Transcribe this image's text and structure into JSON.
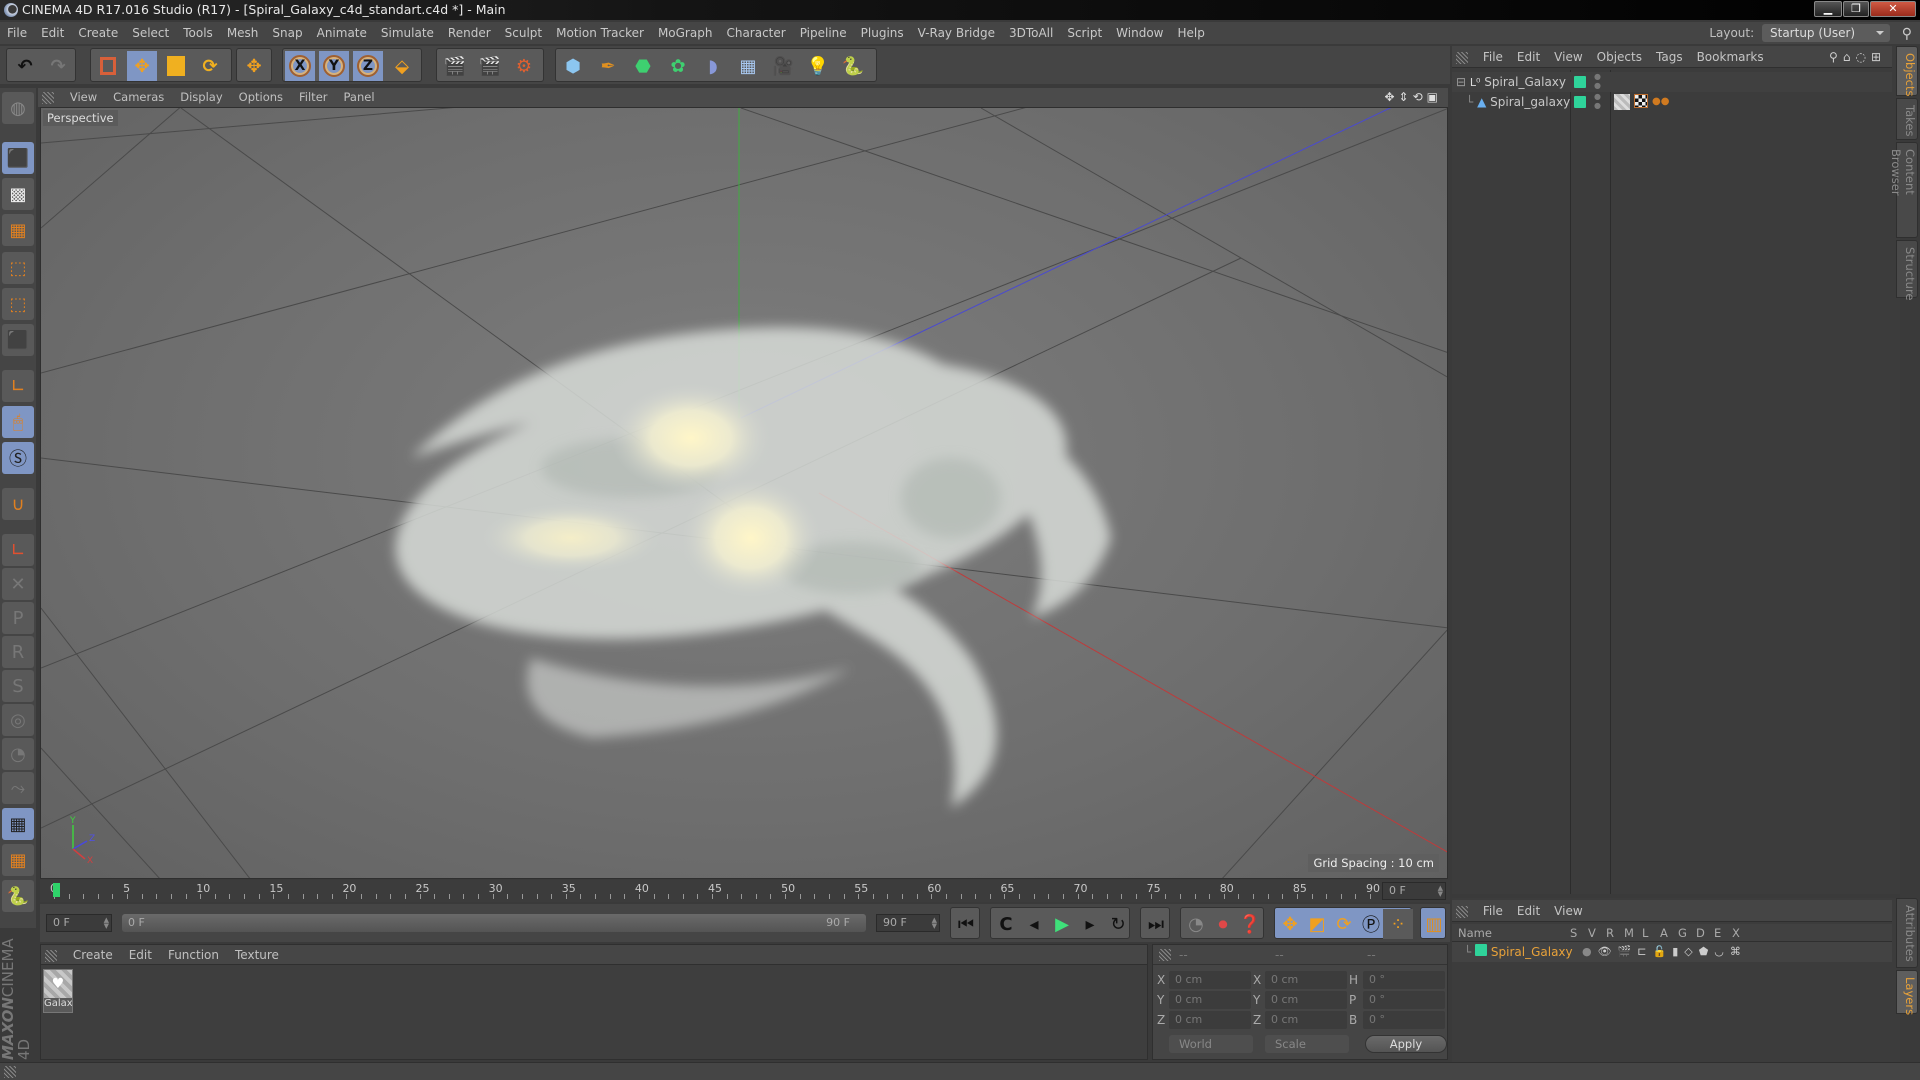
{
  "window": {
    "title": "CINEMA 4D R17.016 Studio (R17) - [Spiral_Galaxy_c4d_standart.c4d *] - Main",
    "controls": [
      "minimize",
      "restore",
      "close"
    ]
  },
  "menubar": {
    "items": [
      "File",
      "Edit",
      "Create",
      "Select",
      "Tools",
      "Mesh",
      "Snap",
      "Animate",
      "Simulate",
      "Render",
      "Sculpt",
      "Motion Tracker",
      "MoGraph",
      "Character",
      "Pipeline",
      "Plugins",
      "V-Ray Bridge",
      "3DToAll",
      "Script",
      "Window",
      "Help"
    ],
    "layout_label": "Layout:",
    "layout_value": "Startup (User)"
  },
  "toolbar": {
    "groups": [
      [
        "undo-icon",
        "redo-icon"
      ],
      [
        "live-selection-icon",
        "move-icon",
        "scale-icon",
        "rotate-icon"
      ],
      [
        "recent-tool-icon"
      ],
      [
        "x-axis-lock-icon",
        "y-axis-lock-icon",
        "z-axis-lock-icon",
        "coordinate-system-icon"
      ],
      [
        "render-view-icon",
        "render-to-picture-viewer-icon",
        "render-settings-icon"
      ],
      [
        "cube-primitive-icon",
        "pen-spline-icon",
        "subdivision-surface-icon",
        "cloner-icon",
        "deformer-icon",
        "floor-icon",
        "camera-icon",
        "light-icon",
        "python-icon"
      ]
    ],
    "axis_labels": [
      "X",
      "Y",
      "Z"
    ]
  },
  "left_tools": [
    "make-editable-icon",
    "model-mode-icon",
    "texture-mode-icon",
    "workplane-mode-icon",
    "points-mode-icon",
    "edges-mode-icon",
    "polygons-mode-icon",
    "axis-mode-icon",
    "tweak-mode-icon",
    "solo-icon",
    "snap-icon",
    "workplane-icon",
    "quantize-icon",
    "lock-p-icon",
    "lock-r-icon",
    "lock-psr-icon",
    "lock-target-icon",
    "lock-camera-icon",
    "lock-misc-icon",
    "lock-workplane-icon",
    "align-workplane-icon",
    "python-script-icon"
  ],
  "viewport": {
    "menu": [
      "View",
      "Cameras",
      "Display",
      "Options",
      "Filter",
      "Panel"
    ],
    "label": "Perspective",
    "grid_spacing": "Grid Spacing : 10 cm",
    "axis_gizmo": [
      "Y",
      "Z",
      "X"
    ]
  },
  "timeline": {
    "ticks": [
      "0",
      "5",
      "10",
      "15",
      "20",
      "25",
      "30",
      "35",
      "40",
      "45",
      "50",
      "55",
      "60",
      "65",
      "70",
      "75",
      "80",
      "85",
      "90"
    ],
    "current_frame_field": "0 F",
    "start_field": "0 F",
    "range_start": "0 F",
    "range_end": "90 F",
    "end_field": "90 F",
    "current_frame_readout": "0 F",
    "playhead_frame": 0,
    "max_frame": 90
  },
  "transport": {
    "buttons": [
      "go-to-start-icon",
      "previous-key-icon",
      "previous-frame-icon",
      "play-icon",
      "next-frame-icon",
      "next-key-icon",
      "go-to-end-icon",
      "motion-record-icon",
      "record-active-icon",
      "autokey-icon",
      "key-position-icon",
      "key-scale-icon",
      "key-rotation-icon",
      "key-parameter-icon",
      "key-pla-icon",
      "timeline-icon"
    ]
  },
  "material_panel": {
    "menu": [
      "Create",
      "Edit",
      "Function",
      "Texture"
    ],
    "materials": [
      {
        "name": "Galax"
      }
    ]
  },
  "coordinates": {
    "headers": [
      "--",
      "--",
      "--"
    ],
    "rows": [
      {
        "l1": "X",
        "v1": "0 cm",
        "l2": "X",
        "v2": "0 cm",
        "l3": "H",
        "v3": "0 °"
      },
      {
        "l1": "Y",
        "v1": "0 cm",
        "l2": "Y",
        "v2": "0 cm",
        "l3": "P",
        "v3": "0 °"
      },
      {
        "l1": "Z",
        "v1": "0 cm",
        "l2": "Z",
        "v2": "0 cm",
        "l3": "B",
        "v3": "0 °"
      }
    ],
    "space_dropdown": "World",
    "mode_dropdown": "Scale",
    "apply_label": "Apply"
  },
  "object_manager": {
    "menu": [
      "File",
      "Edit",
      "View",
      "Objects",
      "Tags",
      "Bookmarks"
    ],
    "objects": [
      {
        "name": "Spiral_Galaxy",
        "icon": "null-object-icon",
        "color": "#2fd39a"
      },
      {
        "name": "Spiral_galaxy",
        "icon": "particle-emitter-icon",
        "color": "#2fd39a",
        "tags": [
          "material-tag-icon",
          "texture-tag-icon",
          "particle-tag-icon"
        ]
      }
    ]
  },
  "right_tabs_top": [
    {
      "label": "Objects",
      "active": true
    },
    {
      "label": "Takes",
      "active": false
    },
    {
      "label": "Content Browser",
      "active": false
    },
    {
      "label": "Structure",
      "active": false
    }
  ],
  "layer_manager": {
    "menu": [
      "File",
      "Edit",
      "View"
    ],
    "columns": [
      "Name",
      "S",
      "V",
      "R",
      "M",
      "L",
      "A",
      "G",
      "D",
      "E",
      "X"
    ],
    "layers": [
      {
        "name": "Spiral_Galaxy",
        "color": "#2fd39a"
      }
    ]
  },
  "right_tabs_bottom": [
    {
      "label": "Attributes",
      "active": false
    },
    {
      "label": "Layers",
      "active": true
    }
  ],
  "brand": {
    "maxon": "MAXON",
    "product": "CINEMA 4D"
  }
}
